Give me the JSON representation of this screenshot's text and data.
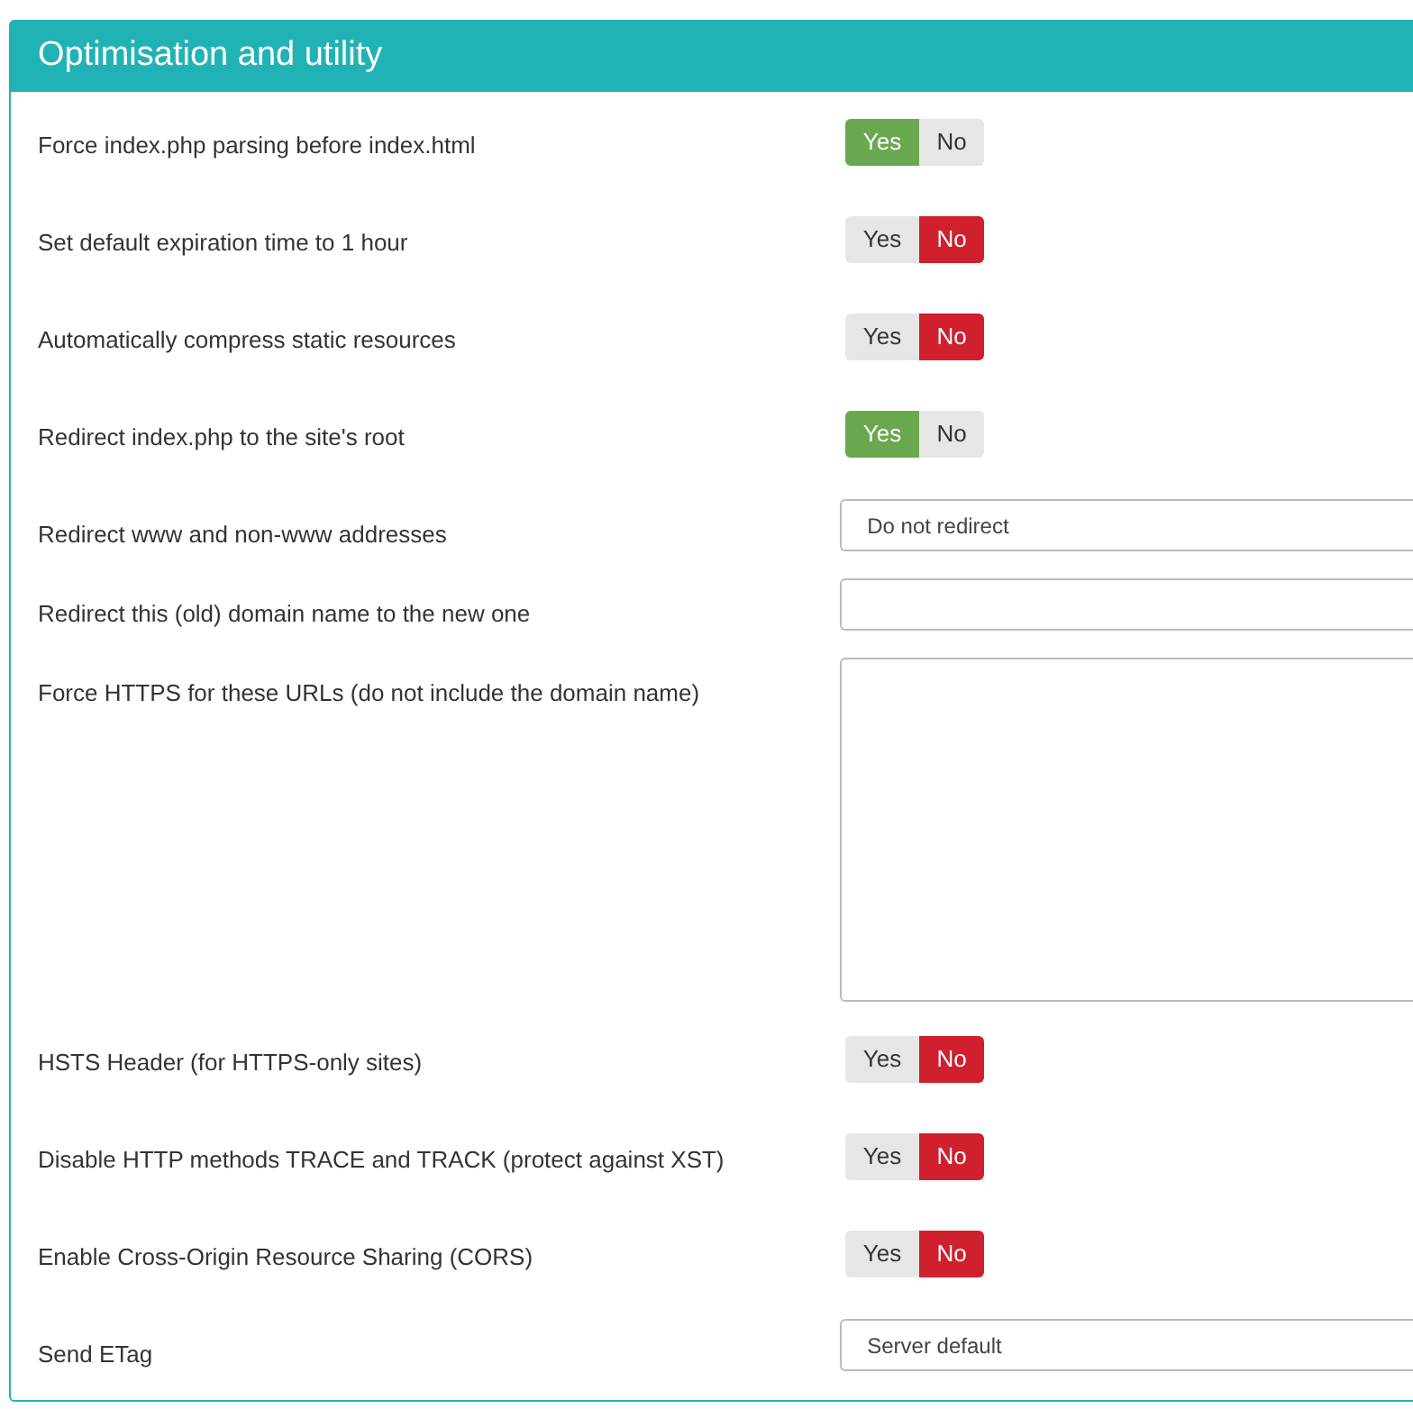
{
  "panel": {
    "title": "Optimisation and utility"
  },
  "settings": [
    {
      "kind": "toggle",
      "label": "Force index.php parsing before index.html",
      "options": [
        {
          "label": "Yes",
          "selected": true
        },
        {
          "label": "No",
          "selected": false
        }
      ]
    },
    {
      "kind": "toggle",
      "label": "Set default expiration time to 1 hour",
      "options": [
        {
          "label": "Yes",
          "selected": false
        },
        {
          "label": "No",
          "selected": true
        }
      ]
    },
    {
      "kind": "toggle",
      "label": "Automatically compress static resources",
      "options": [
        {
          "label": "Yes",
          "selected": false
        },
        {
          "label": "No",
          "selected": true
        }
      ]
    },
    {
      "kind": "toggle",
      "label": "Redirect index.php to the site's root",
      "options": [
        {
          "label": "Yes",
          "selected": true
        },
        {
          "label": "No",
          "selected": false
        }
      ]
    },
    {
      "kind": "select",
      "label": "Redirect www and non-www addresses",
      "value": "Do not redirect"
    },
    {
      "kind": "text",
      "label": "Redirect this (old) domain name to the new one"
    },
    {
      "kind": "textarea",
      "label": "Force HTTPS for these URLs (do not include the domain name)"
    },
    {
      "kind": "toggle",
      "label": "HSTS Header (for HTTPS-only sites)",
      "options": [
        {
          "label": "Yes",
          "selected": false
        },
        {
          "label": "No",
          "selected": true
        }
      ]
    },
    {
      "kind": "toggle",
      "label": "Disable HTTP methods TRACE and TRACK (protect against XST)",
      "options": [
        {
          "label": "Yes",
          "selected": false
        },
        {
          "label": "No",
          "selected": true
        }
      ]
    },
    {
      "kind": "toggle",
      "label": "Enable Cross-Origin Resource Sharing (CORS)",
      "options": [
        {
          "label": "Yes",
          "selected": false
        },
        {
          "label": "No",
          "selected": true
        }
      ]
    },
    {
      "kind": "select",
      "label": "Send ETag",
      "value": "Server default"
    }
  ]
}
